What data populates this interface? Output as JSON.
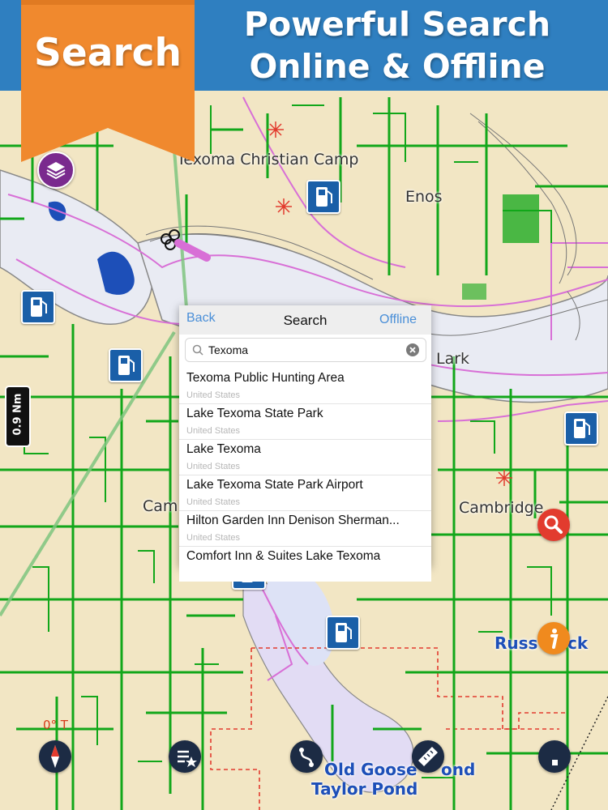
{
  "banner": {
    "ribbon_label": "Search",
    "headline_line1": "Powerful Search",
    "headline_line2": "Online & Offline"
  },
  "map": {
    "labels": {
      "camp": "Texoma Christian Camp",
      "enos": "Enos",
      "lark": "Lark",
      "cambridge": "Cambridge",
      "cam": "Cam",
      "russell": "Russ",
      "russell_end": "ck",
      "old_goose_pond_a": "Old Goose",
      "old_goose_pond_b": "ond",
      "taylor_pond": "Taylor Pond"
    },
    "scale": "0.9 Nm",
    "heading": "0° T",
    "colors": {
      "land": "#f2e6c4",
      "water": "#e8eaf2",
      "roads": "#12a71a",
      "boundaries": "#d86fd6"
    }
  },
  "search_panel": {
    "back_label": "Back",
    "title": "Search",
    "offline_label": "Offline",
    "query": "Texoma",
    "results": [
      {
        "title": "Texoma Public Hunting Area",
        "subtitle": "United States"
      },
      {
        "title": "Lake Texoma State Park",
        "subtitle": "United States"
      },
      {
        "title": "Lake Texoma",
        "subtitle": "United States"
      },
      {
        "title": "Lake Texoma State Park Airport",
        "subtitle": "United States"
      },
      {
        "title": "Hilton Garden Inn Denison Sherman...",
        "subtitle": "United States"
      },
      {
        "title": "Comfort Inn & Suites Lake Texoma",
        "subtitle": ""
      }
    ]
  },
  "icons": {
    "layers": "layers-icon",
    "fuel": "fuel-station-icon",
    "compass": "compass-icon",
    "route": "route-list-icon",
    "track": "track-icon",
    "ruler": "ruler-icon",
    "record": "record-stop-icon",
    "search": "magnifier-icon",
    "info": "info-icon"
  }
}
